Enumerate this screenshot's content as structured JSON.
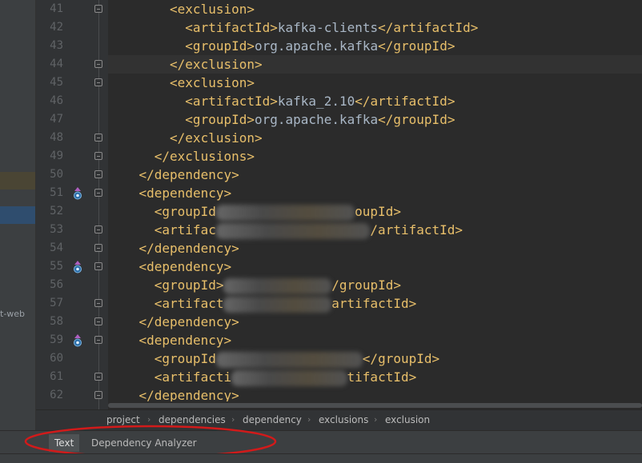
{
  "sidebar": {
    "project_fragment": "t-web"
  },
  "editor": {
    "line_numbers": [
      "41",
      "42",
      "43",
      "44",
      "45",
      "46",
      "47",
      "48",
      "49",
      "50",
      "51",
      "52",
      "53",
      "54",
      "55",
      "56",
      "57",
      "58",
      "59",
      "60",
      "61",
      "62"
    ],
    "lines": [
      {
        "indent": 8,
        "segments": [
          {
            "t": "tag",
            "v": "<exclusion>"
          }
        ]
      },
      {
        "indent": 10,
        "segments": [
          {
            "t": "tag",
            "v": "<artifactId>"
          },
          {
            "t": "txt",
            "v": "kafka-clients"
          },
          {
            "t": "tag",
            "v": "</artifactId>"
          }
        ]
      },
      {
        "indent": 10,
        "segments": [
          {
            "t": "tag",
            "v": "<groupId>"
          },
          {
            "t": "txt",
            "v": "org.apache.kafka"
          },
          {
            "t": "tag",
            "v": "</groupId>"
          }
        ]
      },
      {
        "indent": 8,
        "segments": [
          {
            "t": "tag",
            "v": "</exclusion>"
          }
        ]
      },
      {
        "indent": 8,
        "segments": [
          {
            "t": "tag",
            "v": "<exclusion>"
          }
        ]
      },
      {
        "indent": 10,
        "segments": [
          {
            "t": "tag",
            "v": "<artifactId>"
          },
          {
            "t": "txt",
            "v": "kafka_2.10"
          },
          {
            "t": "tag",
            "v": "</artifactId>"
          }
        ]
      },
      {
        "indent": 10,
        "segments": [
          {
            "t": "tag",
            "v": "<groupId>"
          },
          {
            "t": "txt",
            "v": "org.apache.kafka"
          },
          {
            "t": "tag",
            "v": "</groupId>"
          }
        ]
      },
      {
        "indent": 8,
        "segments": [
          {
            "t": "tag",
            "v": "</exclusion>"
          }
        ]
      },
      {
        "indent": 6,
        "segments": [
          {
            "t": "tag",
            "v": "</exclusions>"
          }
        ]
      },
      {
        "indent": 4,
        "segments": [
          {
            "t": "tag",
            "v": "</dependency>"
          }
        ]
      },
      {
        "indent": 4,
        "segments": [
          {
            "t": "tag",
            "v": "<dependency>"
          }
        ]
      },
      {
        "indent": 6,
        "segments": [
          {
            "t": "tag",
            "v": "<groupId"
          },
          {
            "t": "blur",
            "v": "                  "
          },
          {
            "t": "tag",
            "v": "oupId>"
          }
        ]
      },
      {
        "indent": 6,
        "segments": [
          {
            "t": "tag",
            "v": "<artifac"
          },
          {
            "t": "blur",
            "v": "                    "
          },
          {
            "t": "tag",
            "v": "/artifactId>"
          }
        ]
      },
      {
        "indent": 4,
        "segments": [
          {
            "t": "tag",
            "v": "</dependency>"
          }
        ]
      },
      {
        "indent": 4,
        "segments": [
          {
            "t": "tag",
            "v": "<dependency>"
          }
        ]
      },
      {
        "indent": 6,
        "segments": [
          {
            "t": "tag",
            "v": "<groupId>"
          },
          {
            "t": "blur",
            "v": "              "
          },
          {
            "t": "tag",
            "v": "/groupId>"
          }
        ]
      },
      {
        "indent": 6,
        "segments": [
          {
            "t": "tag",
            "v": "<artifact"
          },
          {
            "t": "blur",
            "v": "              "
          },
          {
            "t": "tag",
            "v": "artifactId>"
          }
        ]
      },
      {
        "indent": 4,
        "segments": [
          {
            "t": "tag",
            "v": "</dependency>"
          }
        ]
      },
      {
        "indent": 4,
        "segments": [
          {
            "t": "tag",
            "v": "<dependency>"
          }
        ]
      },
      {
        "indent": 6,
        "segments": [
          {
            "t": "tag",
            "v": "<groupId"
          },
          {
            "t": "blur",
            "v": "                   "
          },
          {
            "t": "tag",
            "v": "</groupId>"
          }
        ]
      },
      {
        "indent": 6,
        "segments": [
          {
            "t": "tag",
            "v": "<artifacti"
          },
          {
            "t": "blur",
            "v": "               "
          },
          {
            "t": "tag",
            "v": "tifactId>"
          }
        ]
      },
      {
        "indent": 4,
        "segments": [
          {
            "t": "tag",
            "v": "</dependency>"
          }
        ]
      }
    ],
    "caret_line": "44",
    "fold_marker_lines": [
      "41",
      "44",
      "45",
      "48",
      "49",
      "50",
      "51",
      "53",
      "54",
      "55",
      "57",
      "58",
      "59",
      "61",
      "62"
    ],
    "maven_icon_lines": [
      "51",
      "55",
      "59"
    ],
    "maven_icon": "maven-override-icon",
    "bulb_icon": "lightbulb-icon",
    "bulb_line": "44"
  },
  "breadcrumb": {
    "items": [
      "project",
      "dependencies",
      "dependency",
      "exclusions",
      "exclusion"
    ],
    "separator_icon": "chevron-right-icon"
  },
  "tabs": {
    "items": [
      {
        "label": "Text",
        "active": true
      },
      {
        "label": "Dependency Analyzer",
        "active": false
      }
    ]
  },
  "annotation": {
    "shape": "ellipse",
    "color": "#d21a1a"
  },
  "colors": {
    "tag": "#e8bf6a",
    "text": "#a9b7c6",
    "background": "#2b2b2b",
    "gutter": "#313335"
  }
}
